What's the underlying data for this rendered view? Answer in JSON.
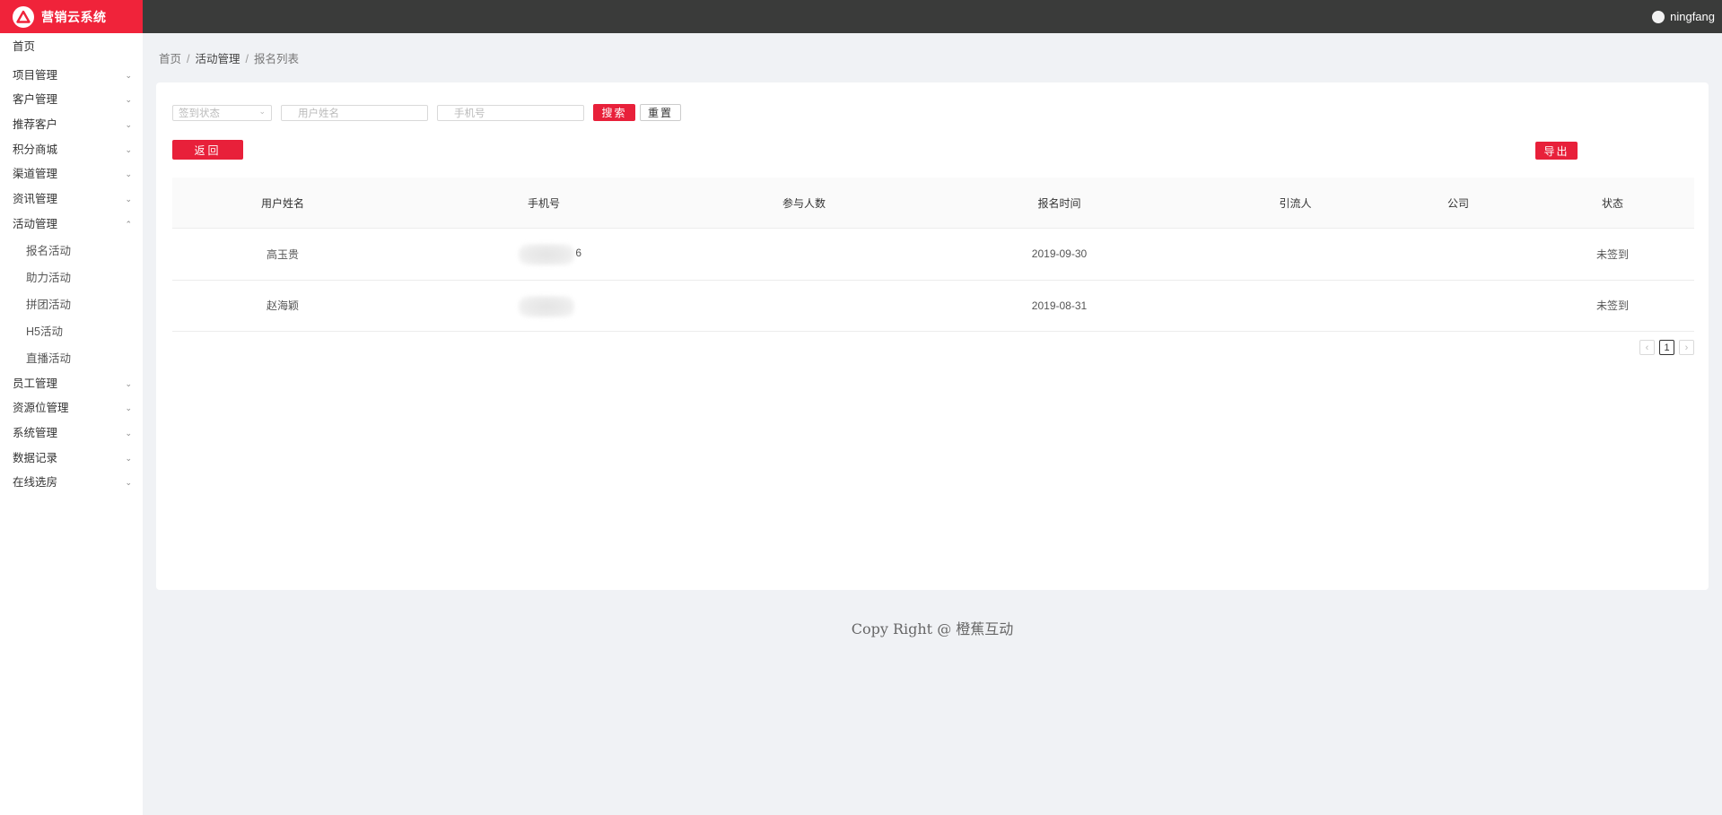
{
  "app": {
    "title": "营销云系统",
    "brand_color": "#f0233a",
    "header_color": "#3a3b3a"
  },
  "user": {
    "name": "ningfang"
  },
  "sidebar": {
    "items": [
      {
        "label": "首页",
        "chevron": ""
      },
      {
        "label": "项目管理",
        "chevron": "⌄"
      },
      {
        "label": "客户管理",
        "chevron": "⌄"
      },
      {
        "label": "推荐客户",
        "chevron": "⌄"
      },
      {
        "label": "积分商城",
        "chevron": "⌄"
      },
      {
        "label": "渠道管理",
        "chevron": "⌄"
      },
      {
        "label": "资讯管理",
        "chevron": "⌄"
      },
      {
        "label": "活动管理",
        "chevron": "⌃"
      }
    ],
    "sub_items": [
      "报名活动",
      "助力活动",
      "拼团活动",
      "H5活动",
      "直播活动"
    ],
    "items_after": [
      {
        "label": "员工管理",
        "chevron": "⌄"
      },
      {
        "label": "资源位管理",
        "chevron": "⌄"
      },
      {
        "label": "系统管理",
        "chevron": "⌄"
      },
      {
        "label": "数据记录",
        "chevron": "⌄"
      },
      {
        "label": "在线选房",
        "chevron": "⌄"
      }
    ]
  },
  "breadcrumb": {
    "home": "首页",
    "section": "活动管理",
    "current": "报名列表",
    "separator": "/"
  },
  "filters": {
    "status_placeholder": "签到状态",
    "name_placeholder": "用户姓名",
    "phone_placeholder": "手机号",
    "search_label": "搜索",
    "reset_label": "重置"
  },
  "actions": {
    "back_label": "返回",
    "export_label": "导出"
  },
  "table": {
    "columns": [
      "用户姓名",
      "手机号",
      "参与人数",
      "报名时间",
      "引流人",
      "公司",
      "状态"
    ],
    "rows": [
      {
        "name": "高玉贵",
        "phone_tail": "6",
        "participants": "",
        "time": "2019-09-30",
        "referrer": "",
        "company": "",
        "status": "未签到"
      },
      {
        "name": "赵海颖",
        "phone_tail": "",
        "participants": "",
        "time": "2019-08-31",
        "referrer": "",
        "company": "",
        "status": "未签到"
      }
    ]
  },
  "pagination": {
    "prev": "‹",
    "current": "1",
    "next": "›"
  },
  "footer": {
    "text": "Copy Right @ 橙蕉互动"
  }
}
